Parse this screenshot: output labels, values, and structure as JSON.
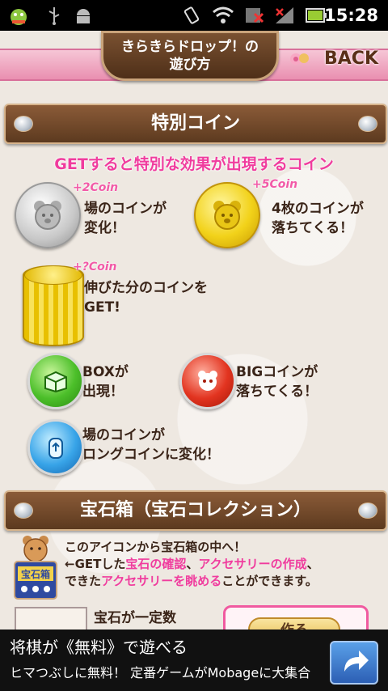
{
  "status_bar": {
    "time": "15:28",
    "icons": [
      "android-debug-icon",
      "usb-icon",
      "android-icon",
      "vibrate-icon",
      "wifi-icon",
      "mobile-data-off-icon",
      "signal-icon",
      "battery-icon"
    ]
  },
  "header": {
    "title": "きらきらドロップ！の\n遊び方",
    "back_label": "BACK"
  },
  "sections": [
    {
      "title": "特別コイン"
    },
    {
      "title": "宝石箱（宝石コレクション）"
    }
  ],
  "special_coins": {
    "subtitle": "GETすると特別な効果が出現するコイン",
    "items": [
      {
        "bonus": "+2Coin",
        "text": "場のコインが\n変化！",
        "color": "silver"
      },
      {
        "bonus": "+5Coin",
        "text": "4枚のコインが\n落ちてくる！",
        "color": "gold"
      },
      {
        "bonus": "+?Coin",
        "text": "伸びた分のコインを\nGET!",
        "color": "gold-long"
      },
      {
        "bonus": "",
        "text": "BOXが\n出現！",
        "color": "green"
      },
      {
        "bonus": "",
        "text": "BIGコインが\n落ちてくる！",
        "color": "red"
      },
      {
        "bonus": "",
        "text": "場のコインが\nロングコインに変化！",
        "color": "blue"
      }
    ]
  },
  "treasure": {
    "line1": "このアイコンから宝石箱の中へ！",
    "line2_a": "←GETした",
    "line2_b": "宝石の確認",
    "line2_c": "、",
    "line2_d": "アクセサリーの作成",
    "line2_e": "、",
    "line3_a": "できた",
    "line3_b": "アクセサリーを眺める",
    "line3_c": "ことができます。",
    "icon_label": "宝石箱",
    "partial_text": "宝石が一定数",
    "partial_button": "作る"
  },
  "ad": {
    "line1": "将棋が《無料》で遊べる",
    "line2": "ヒマつぶしに無料！ 定番ゲームがMobageに大集合"
  },
  "colors": {
    "pink": "#f03c9e",
    "brown": "#5c3a1f",
    "header_pink": "#e98fb0"
  }
}
